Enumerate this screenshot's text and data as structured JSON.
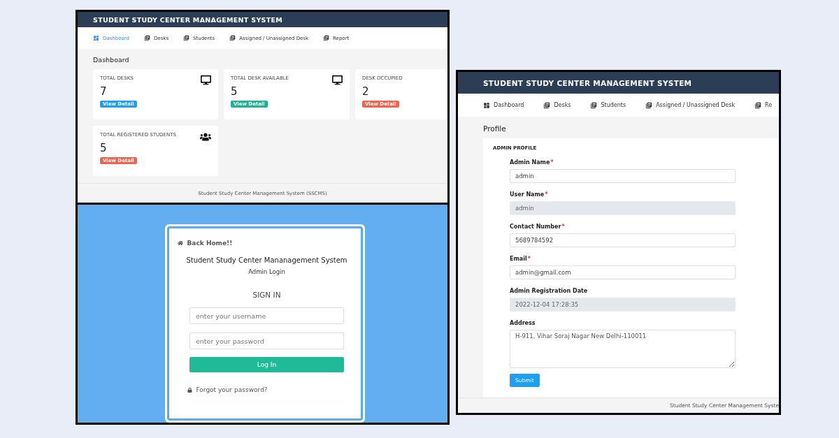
{
  "dashboard_window": {
    "header_title": "STUDENT STUDY CENTER MANAGEMENT SYSTEM",
    "nav": [
      {
        "label": "Dashboard",
        "kind": "dashboard",
        "selected": true
      },
      {
        "label": "Desks",
        "kind": "pages",
        "selected": false
      },
      {
        "label": "Students",
        "kind": "pages",
        "selected": false
      },
      {
        "label": "Assigned / Unassigned Desk",
        "kind": "pages",
        "selected": false
      },
      {
        "label": "Report",
        "kind": "pages",
        "selected": false
      }
    ],
    "page_title": "Dashboard",
    "cards": [
      {
        "title": "TOTAL DESKS",
        "value": "7",
        "kind": "monitor",
        "button": "View Detail",
        "color": "#1e9ff2"
      },
      {
        "title": "TOTAL DESK AVAILABLE",
        "value": "5",
        "kind": "monitor",
        "button": "View Detail",
        "color": "#20b28f"
      },
      {
        "title": "DESK OCCUPIED",
        "value": "2",
        "button": "View Detail",
        "color": "#f2624c"
      },
      {
        "title": "TOTAL REGISTERED STUDENTS",
        "value": "5",
        "kind": "users",
        "button": "View Detail",
        "color": "#f2624c"
      }
    ],
    "footer": "Student Study Center Management System (SSCMS)"
  },
  "login_window": {
    "back_link": "Back Home!!",
    "system_name": "Student Study Center Mananagement System",
    "subtitle": "Admin Login",
    "heading": "SIGN IN",
    "fields": [
      {
        "placeholder": "enter your username"
      },
      {
        "placeholder": "enter your password"
      }
    ],
    "button": "Log In",
    "forgot_link": "Forgot your password?"
  },
  "profile_window": {
    "header_title": "STUDENT STUDY CENTER MANAGEMENT SYSTEM",
    "nav": [
      {
        "label": "Dashboard",
        "kind": "dashboard",
        "selected": false
      },
      {
        "label": "Desks",
        "kind": "pages",
        "selected": false
      },
      {
        "label": "Students",
        "kind": "pages",
        "selected": false
      },
      {
        "label": "Assigned / Unassigned Desk",
        "kind": "pages",
        "selected": false
      },
      {
        "label": "Re",
        "kind": "pages",
        "selected": false
      }
    ],
    "page_title": "Profile",
    "card_title": "ADMIN PROFILE",
    "fields": [
      {
        "label": "Admin Name",
        "mark": "*",
        "value": "admin",
        "kind": "input",
        "readonly": false
      },
      {
        "label": "User Name",
        "mark": "*",
        "value": "admin",
        "kind": "input",
        "readonly": true
      },
      {
        "label": "Contact Number",
        "mark": "*",
        "value": "5689784592",
        "kind": "input",
        "readonly": false
      },
      {
        "label": "Email",
        "mark": "*",
        "value": "admin@gmail.com",
        "kind": "input",
        "readonly": false
      },
      {
        "label": "Admin Registration Date",
        "value": "2022-12-04 17:28:35",
        "kind": "input",
        "readonly": true
      },
      {
        "label": "Address",
        "value": "H-911, Vihar Soraj Nagar New Delhi-110011",
        "kind": "textarea"
      }
    ],
    "submit": "Submit",
    "footer": "Student Study Center Management Syste"
  }
}
